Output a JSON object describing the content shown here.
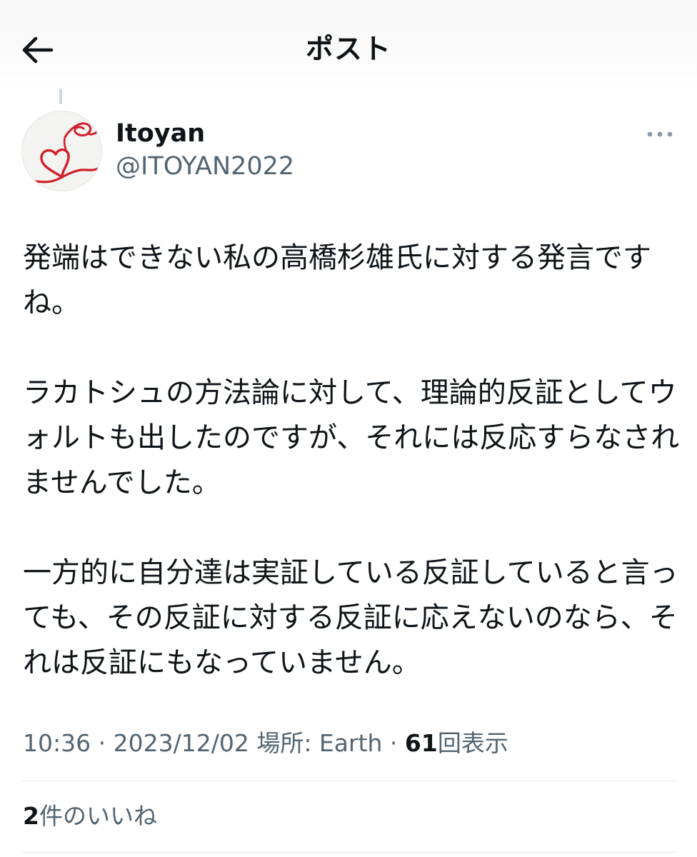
{
  "header": {
    "title": "ポスト",
    "back_icon": "arrow-left-icon"
  },
  "author": {
    "display_name": "Itoyan",
    "handle": "@ITOYAN2022",
    "avatar_icon": "red-heart-string-avatar",
    "more_icon": "more-horizontal-icon"
  },
  "post": {
    "text": "発端はできない私の高橋杉雄氏に対する発言ですね。\n\nラカトシュの方法論に対して、理論的反証としてウォルトも出したのですが、それには反応すらなされませんでした。\n\n一方的に自分達は実証している反証していると言っても、その反証に対する反証に応えないのなら、それは反証にもなっていません。"
  },
  "meta": {
    "time": "10:36",
    "separator": "·",
    "date": "2023/12/02",
    "location_label": "場所: Earth",
    "views_count": "61",
    "views_label": "回表示"
  },
  "engagement": {
    "likes_count": "2",
    "likes_label": "件のいいね"
  },
  "colors": {
    "text_primary": "#0f1419",
    "text_secondary": "#536471",
    "divider": "#e3e7ea",
    "avatar_string": "#d0202a"
  }
}
